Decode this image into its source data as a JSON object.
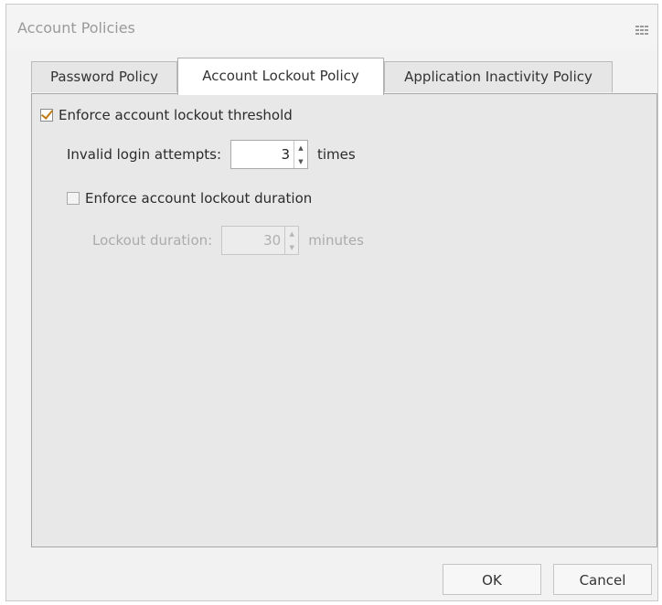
{
  "window": {
    "title": "Account Policies",
    "title_icon": "grip-icon"
  },
  "tabs": [
    {
      "label": "Password Policy",
      "active": false
    },
    {
      "label": "Account Lockout Policy",
      "active": true
    },
    {
      "label": "Application Inactivity Policy",
      "active": false
    }
  ],
  "lockout": {
    "enforce_threshold": {
      "label": "Enforce account lockout threshold",
      "checked": true
    },
    "invalid_attempts": {
      "label": "Invalid login attempts:",
      "value": "3",
      "unit": "times"
    },
    "enforce_duration": {
      "label": "Enforce account lockout duration",
      "checked": false
    },
    "duration": {
      "label": "Lockout duration:",
      "value": "30",
      "unit": "minutes",
      "enabled": false
    }
  },
  "buttons": {
    "ok": "OK",
    "cancel": "Cancel"
  },
  "colors": {
    "check_accent": "#c07a10",
    "panel_bg": "#e8e8e8",
    "dialog_bg": "#f2f2f2"
  }
}
